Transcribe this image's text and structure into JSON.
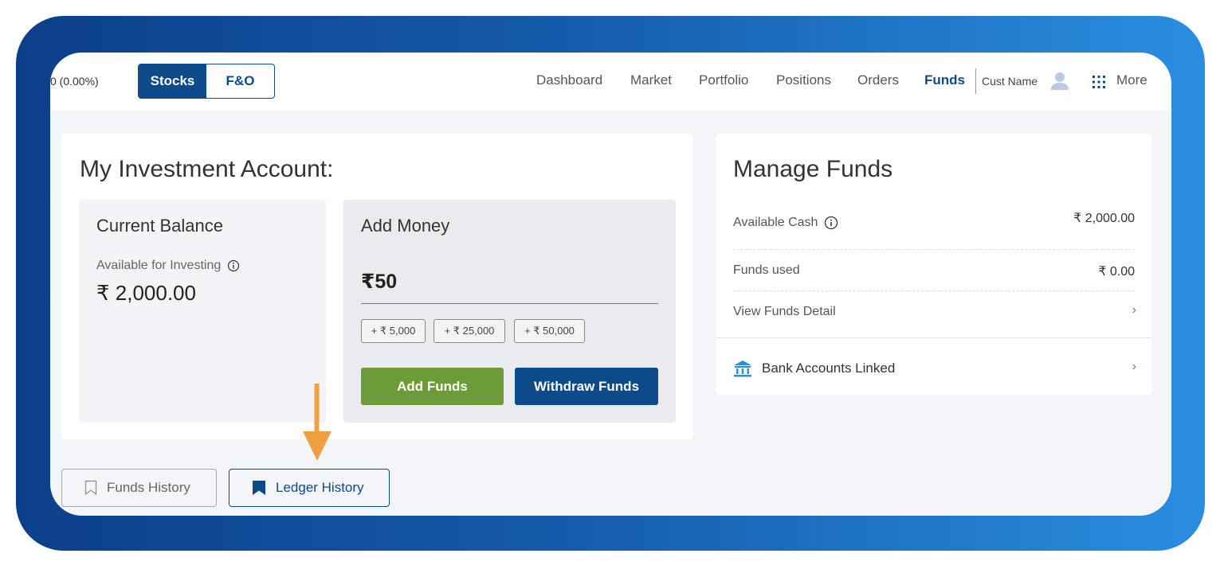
{
  "topbar": {
    "ticker": "0 (0.00%)",
    "segments": [
      "Stocks",
      "F&O"
    ],
    "nav": [
      "Dashboard",
      "Market",
      "Portfolio",
      "Positions",
      "Orders",
      "Funds"
    ],
    "customer_name": "Cust Name",
    "more_label": "More"
  },
  "investment": {
    "heading": "My Investment Account:",
    "balance": {
      "title": "Current Balance",
      "subtitle": "Available for Investing",
      "value": "₹ 2,000.00"
    },
    "add_money": {
      "title": "Add Money",
      "amount": "₹50",
      "chips": [
        "+ ₹ 5,000",
        "+ ₹ 25,000",
        "+ ₹ 50,000"
      ],
      "add_label": "Add Funds",
      "withdraw_label": "Withdraw Funds"
    }
  },
  "manage": {
    "heading": "Manage Funds",
    "available_cash_label": "Available Cash",
    "available_cash_value": "₹ 2,000.00",
    "funds_used_label": "Funds used",
    "funds_used_value": "₹ 0.00",
    "view_detail_label": "View Funds Detail",
    "bank_label": "Bank Accounts Linked",
    "chevron": "›"
  },
  "history": {
    "funds_label": "Funds History",
    "ledger_label": "Ledger History"
  },
  "colors": {
    "primary": "#0d4a8a",
    "green": "#6e9b3a",
    "accent_blue": "#2a8ee0",
    "arrow": "#f0a040"
  }
}
